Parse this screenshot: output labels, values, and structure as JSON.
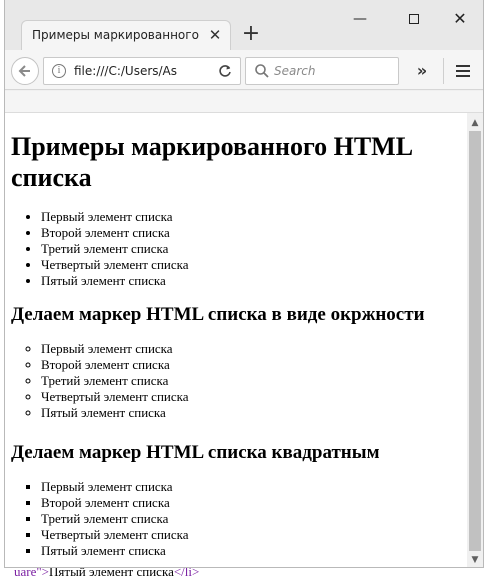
{
  "browser": {
    "tab_title": "Примеры маркированного ...",
    "tab_close": "✕",
    "new_tab": "+",
    "url": "file:///C:/Users/As",
    "search_placeholder": "Search",
    "overflow": "»",
    "window_controls": {
      "minimize": "—",
      "close": "✕"
    }
  },
  "page": {
    "heading": "Примеры маркированного HTML списка",
    "list_disc": [
      "Первый элемент списка",
      "Второй элемент списка",
      "Третий элемент списка",
      "Четвертый элемент списка",
      "Пятый элемент списка"
    ],
    "heading_circle": "Делаем маркер HTML списка в виде окржности",
    "list_circle": [
      "Первый элемент списка",
      "Второй элемент списка",
      "Третий элемент списка",
      "Четвертый элемент списка",
      "Пятый элемент списка"
    ],
    "heading_square": "Делаем маркер HTML списка квадратным",
    "list_square": [
      "Первый элемент списка",
      "Второй элемент списка",
      "Третий элемент списка",
      "Четвертый элемент списка",
      "Пятый элемент списка"
    ]
  },
  "background_editor": {
    "bottom_line_tag": "uare\">",
    "bottom_line_text": "Пятый элемент списка",
    "bottom_line_close": "</li>"
  },
  "colors": {
    "editor_tag": "#7a1fa2",
    "scroll_thumb": "#c1c1c1"
  }
}
